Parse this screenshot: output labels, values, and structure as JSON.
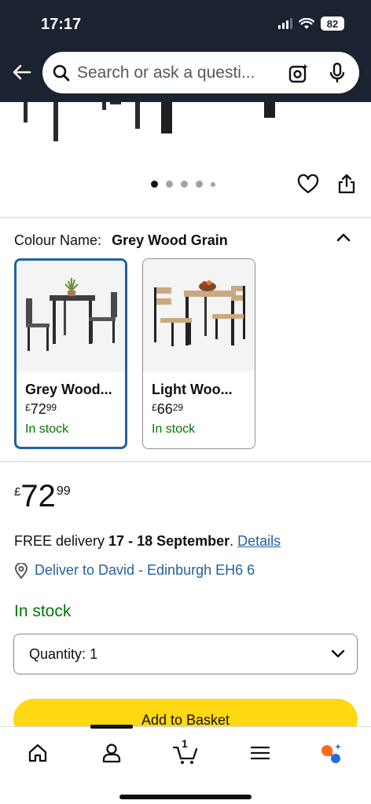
{
  "status_bar": {
    "time": "17:17",
    "battery": "82"
  },
  "search": {
    "placeholder": "Search or ask a questi..."
  },
  "gallery": {
    "total_dots": 5,
    "active_dot": 1
  },
  "variation": {
    "label": "Colour Name:",
    "selected_value": "Grey Wood Grain",
    "options": [
      {
        "name": "Grey Wood...",
        "currency": "£",
        "price_whole": "72",
        "price_fraction": "99",
        "stock": "In stock",
        "selected": true
      },
      {
        "name": "Light Woo...",
        "currency": "£",
        "price_whole": "66",
        "price_fraction": "29",
        "stock": "In stock",
        "selected": false
      }
    ]
  },
  "price": {
    "currency": "£",
    "whole": "72",
    "fraction": "99"
  },
  "delivery": {
    "prefix": "FREE delivery ",
    "dates": "17 - 18 September",
    "suffix": ". ",
    "details_link": "Details"
  },
  "location": {
    "text": "Deliver to David - Edinburgh EH6 6"
  },
  "stock_status": "In stock",
  "quantity": {
    "label": "Quantity:",
    "value": "1"
  },
  "add_to_basket": "Add to Basket",
  "bottom_nav": {
    "cart_count": "1"
  },
  "colors": {
    "header_bg": "#1b2230",
    "link": "#2162a1",
    "in_stock": "#007600",
    "basket_button": "#ffd814",
    "selected_border": "#2162a1"
  }
}
